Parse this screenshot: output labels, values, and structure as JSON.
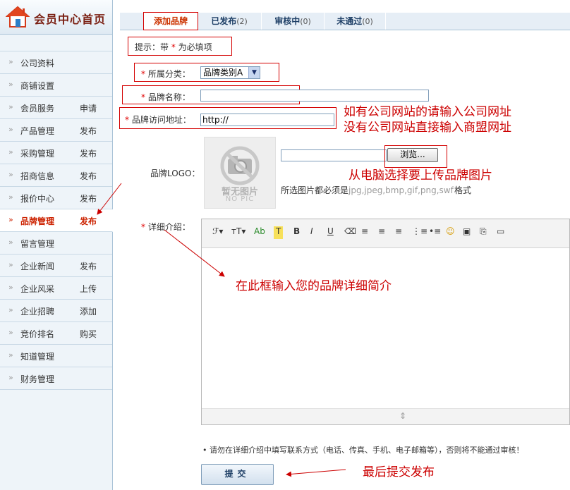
{
  "sidebar": {
    "title": "会员中心首页",
    "items": [
      {
        "label": "公司资料",
        "action": ""
      },
      {
        "label": "商铺设置",
        "action": ""
      },
      {
        "label": "会员服务",
        "action": "申请"
      },
      {
        "label": "产品管理",
        "action": "发布"
      },
      {
        "label": "采购管理",
        "action": "发布"
      },
      {
        "label": "招商信息",
        "action": "发布"
      },
      {
        "label": "报价中心",
        "action": "发布"
      },
      {
        "label": "品牌管理",
        "action": "发布",
        "active": true
      },
      {
        "label": "留言管理",
        "action": ""
      },
      {
        "label": "企业新闻",
        "action": "发布"
      },
      {
        "label": "企业风采",
        "action": "上传"
      },
      {
        "label": "企业招聘",
        "action": "添加"
      },
      {
        "label": "竞价排名",
        "action": "购买"
      },
      {
        "label": "知道管理",
        "action": ""
      },
      {
        "label": "财务管理",
        "action": ""
      }
    ]
  },
  "tabs": [
    {
      "label": "添加品牌",
      "count": ""
    },
    {
      "label": "已发布",
      "count": "(2)"
    },
    {
      "label": "审核中",
      "count": "(0)"
    },
    {
      "label": "未通过",
      "count": "(0)"
    }
  ],
  "form": {
    "hint_prefix": "提示：带",
    "hint_star": "*",
    "hint_suffix": "为必填项",
    "category_label": "所属分类：",
    "category_value": "品牌类别A",
    "name_label": "品牌名称：",
    "name_value": "",
    "url_label": "品牌访问地址：",
    "url_value": "http://",
    "logo_label": "品牌LOGO：",
    "browse_label": "浏览...",
    "nopic_text": "暂无图片",
    "nopic_sub": "NO PIC",
    "file_note": "所选图片都必须是",
    "file_types": "jpg,jpeg,bmp,gif,png,swf",
    "file_suffix": "格式",
    "detail_label": "详细介绍：",
    "notice": "• 请勿在详细介绍中填写联系方式（电话、传真、手机、电子邮箱等），否则将不能通过审核！",
    "submit_label": "提交"
  },
  "toolbar_buttons": [
    {
      "glyph": "ℱ▾",
      "icon": "font-family-icon"
    },
    {
      "glyph": "ᴛT▾",
      "icon": "font-size-icon"
    },
    {
      "glyph": "Ab",
      "icon": "font-color-icon"
    },
    {
      "glyph": "T",
      "icon": "highlight-icon"
    },
    {
      "glyph": "B",
      "icon": "bold-icon"
    },
    {
      "glyph": "I",
      "icon": "italic-icon"
    },
    {
      "glyph": "U",
      "icon": "underline-icon"
    },
    {
      "glyph": "⌫",
      "icon": "eraser-icon"
    },
    {
      "glyph": "≡",
      "icon": "align-left-icon"
    },
    {
      "glyph": "≡",
      "icon": "align-center-icon"
    },
    {
      "glyph": "≡",
      "icon": "align-right-icon"
    },
    {
      "glyph": "⋮≡",
      "icon": "ordered-list-icon"
    },
    {
      "glyph": "•≡",
      "icon": "unordered-list-icon"
    },
    {
      "glyph": "☺",
      "icon": "emoticon-icon"
    },
    {
      "glyph": "▣",
      "icon": "insert-image-icon"
    },
    {
      "glyph": "⎘",
      "icon": "insert-flash-icon"
    },
    {
      "glyph": "▭",
      "icon": "insert-media-icon"
    }
  ],
  "annotations": {
    "url_note_1": "如有公司网站的请输入公司网址",
    "url_note_2": "没有公司网站直接输入商盟网址",
    "logo_note": "从电脑选择要上传品牌图片",
    "detail_note": "在此框输入您的品牌详细简介",
    "submit_note": "最后提交发布"
  },
  "colors": {
    "annotation": "#cc0000",
    "active_tab": "#cc3300",
    "sidebar_bg": "#eef4f9"
  }
}
